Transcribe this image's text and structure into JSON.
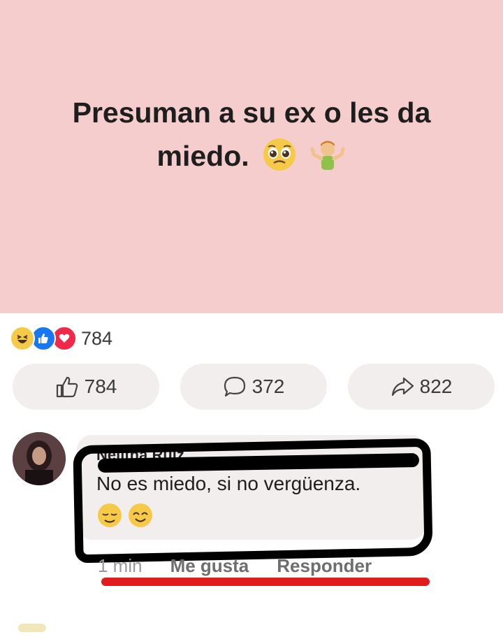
{
  "post": {
    "text": "Presuman a su ex o les da miedo.",
    "background_color": "#f5cdcd",
    "emojis": [
      "pleading-face-icon",
      "man-shrugging-icon"
    ]
  },
  "reactions": {
    "icons": [
      "haha-icon",
      "like-icon",
      "love-icon"
    ],
    "count": "784"
  },
  "actions": {
    "like_count": "784",
    "comment_count": "372",
    "share_count": "822"
  },
  "comment": {
    "author": "Nelitha Ruiz",
    "text": "No es miedo, si no vergüenza.",
    "emojis": [
      "relieved-face-icon",
      "smiling-eyes-icon"
    ],
    "time": "1 min",
    "like_label": "Me gusta",
    "reply_label": "Responder"
  }
}
